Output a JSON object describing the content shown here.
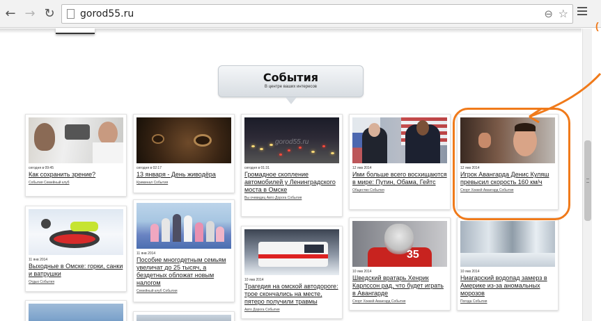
{
  "browser": {
    "url": "gorod55.ru",
    "icons": [
      "back-arrow-icon",
      "forward-arrow-icon",
      "reload-icon",
      "page-icon",
      "zoom-icon",
      "star-icon",
      "menu-icon"
    ]
  },
  "section": {
    "title": "События",
    "subtitle": "В центре ваших интересов"
  },
  "cards": [
    {
      "date": "сегодня в 09:45",
      "title": "Как сохранить зрение?",
      "tags": "События Семейный клуб"
    },
    {
      "date": "сегодня в 02:17",
      "title": "13 января - День живодёра",
      "tags": "Криминал События"
    },
    {
      "date": "сегодня в 01:31",
      "title": "Громадное скопление автомобилей у Ленинградского моста в Омске",
      "tags": "Вы очевидец Авто Дорога События",
      "watermark": "gorod55.ru"
    },
    {
      "date": "12 янв 2014",
      "title": "Ими больше всего восхищаются в мире: Путин, Обама, Гейтс",
      "tags": "Общество События"
    },
    {
      "date": "12 янв 2014",
      "title": "Игрок Авангарда Денис Куляш превысил скорость 160 км/ч",
      "tags": "Спорт Хоккей Авангард События"
    },
    {
      "date": "11 янв 2014",
      "title": "Выходные в Омске: горки, санки и ватрушки",
      "tags": "Отдых События"
    },
    {
      "date": "11 янв 2014",
      "title": "Пособие многодетным семьям увеличат до 25 тысяч, а бездетных обложат новым налогом",
      "tags": "Семейный клуб События"
    },
    {
      "date": "10 янв 2014",
      "title": "Трагедия на омской автодороге: трое скончались на месте, пятеро получили травмы",
      "tags": "Авто Дорога События"
    },
    {
      "date": "10 янв 2014",
      "title": "Шведский вратарь Хенрик Карлссон рад, что будет играть в Авангарде",
      "tags": "Спорт Хоккей Авангард События"
    },
    {
      "date": "10 янв 2014",
      "title": "Ниагарский водопад замерз в Америке из-за аномальных морозов",
      "tags": "Погода События"
    }
  ],
  "goalie_number": "35",
  "colors": {
    "annotation": "#f07a1a",
    "chrome": "#f2f2f2"
  }
}
